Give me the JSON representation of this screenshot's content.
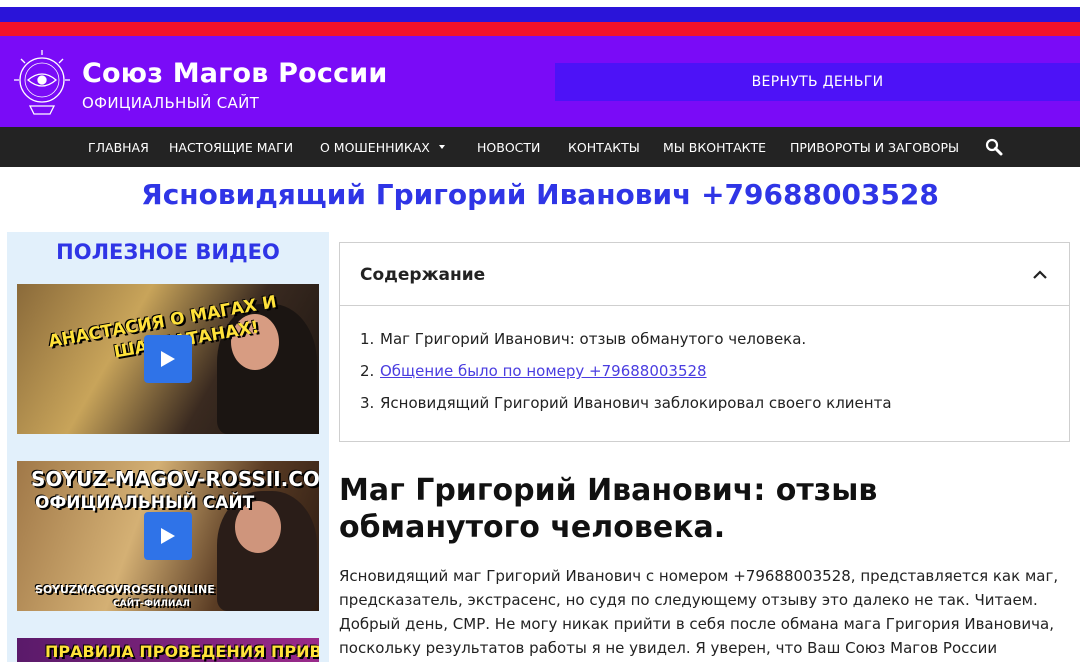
{
  "header": {
    "site_title": "Союз Магов России",
    "site_subtitle": "ОФИЦИАЛЬНЫЙ САЙТ",
    "refund_button": "ВЕРНУТЬ ДЕНЬГИ",
    "logo_icon": "crystal-ball-eye-icon",
    "colors": {
      "stripe_blue": "#2a14d9",
      "stripe_red": "#f2122a",
      "header_bg": "#7a0bf7",
      "button_bg": "#4d12f7"
    }
  },
  "nav": {
    "items": [
      {
        "label": "ГЛАВНАЯ"
      },
      {
        "label": "НАСТОЯЩИЕ МАГИ"
      },
      {
        "label": "О МОШЕННИКАХ"
      },
      {
        "label": "НОВОСТИ"
      },
      {
        "label": "КОНТАКТЫ"
      },
      {
        "label": "МЫ ВКОНТАКТЕ"
      },
      {
        "label": "ПРИВОРОТЫ И ЗАГОВОРЫ"
      }
    ],
    "search_icon": "search-icon"
  },
  "page": {
    "title": "Ясновидящий Григорий Иванович +79688003528"
  },
  "sidebar": {
    "title": "ПОЛЕЗНОЕ ВИДЕО",
    "videos": [
      {
        "line1": "АНАСТАСИЯ О МАГАХ И",
        "line2": "ШАРЛАТАНАХ!"
      },
      {
        "line1": "SOYUZ-MAGOV-ROSSII.COM",
        "line2": "ОФИЦИАЛЬНЫЙ САЙТ",
        "line3": "SOYUZMAGOVROSSII.ONLINE",
        "line4": "САЙТ-ФИЛИАЛ"
      },
      {
        "line1": "ПРАВИЛА ПРОВЕДЕНИЯ ПРИВОРОТА!"
      }
    ]
  },
  "toc": {
    "title": "Содержание",
    "items": [
      {
        "num": "1.",
        "label": "Маг Григорий Иванович: отзыв обманутого человека."
      },
      {
        "num": "2.",
        "label": "Общение было по номеру +79688003528"
      },
      {
        "num": "3.",
        "label": "Ясновидящий Григорий Иванович заблокировал своего клиента"
      }
    ]
  },
  "article": {
    "heading": "Маг Григорий Иванович: отзыв обманутого человека.",
    "paragraph": "Ясновидящий маг Григорий Иванович с номером +79688003528, представляется как маг, предсказатель, экстрасенс, но судя по следующему отзыву это далеко не так. Читаем. Добрый день, СМР.  Не могу никак прийти в себя после обмана мага Григория Ивановича, поскольку результатов работы я не увидел. Я уверен, что Ваш Союз Магов России заинтересуется сайтом"
  }
}
